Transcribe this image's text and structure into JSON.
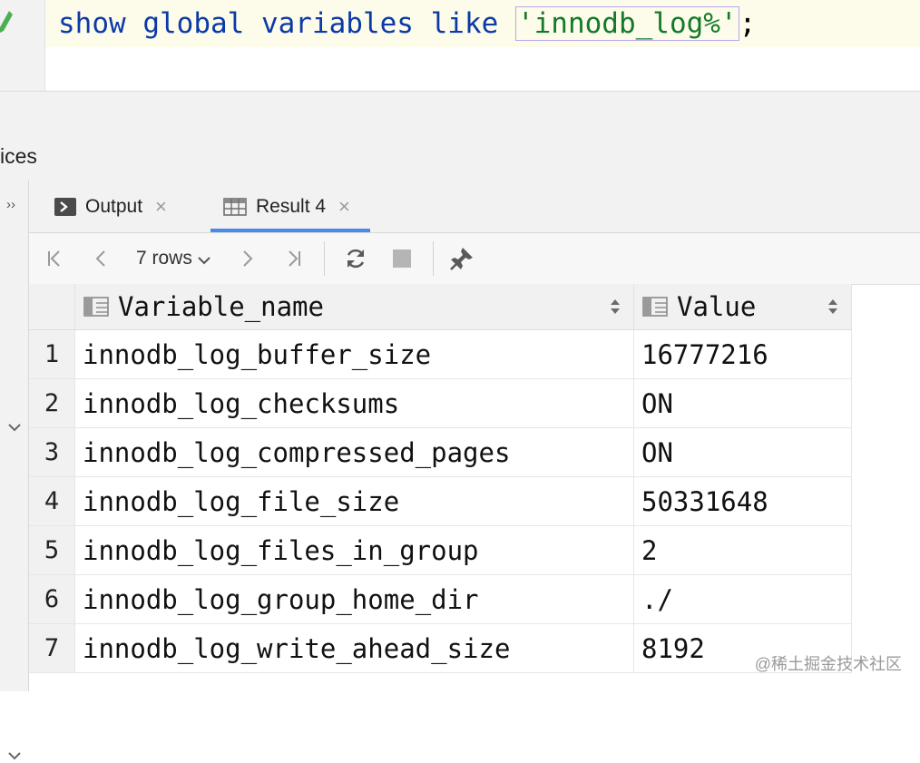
{
  "editor": {
    "query_kw1": "show",
    "query_kw2": "global",
    "query_kw3": "variables",
    "query_kw4": "like",
    "query_string": "'innodb_log%'",
    "query_end": ";"
  },
  "services_panel": {
    "title": "ices"
  },
  "tabs": [
    {
      "label": "Output",
      "close": "×"
    },
    {
      "label": "Result 4",
      "close": "×"
    }
  ],
  "toolbar": {
    "rows_label": "7 rows"
  },
  "table": {
    "columns": [
      {
        "label": "Variable_name"
      },
      {
        "label": "Value"
      }
    ],
    "rows": [
      {
        "num": "1",
        "name": "innodb_log_buffer_size",
        "value": "16777216"
      },
      {
        "num": "2",
        "name": "innodb_log_checksums",
        "value": "ON"
      },
      {
        "num": "3",
        "name": "innodb_log_compressed_pages",
        "value": "ON"
      },
      {
        "num": "4",
        "name": "innodb_log_file_size",
        "value": "50331648"
      },
      {
        "num": "5",
        "name": "innodb_log_files_in_group",
        "value": "2"
      },
      {
        "num": "6",
        "name": "innodb_log_group_home_dir",
        "value": "./"
      },
      {
        "num": "7",
        "name": "innodb_log_write_ahead_size",
        "value": "8192"
      }
    ]
  },
  "watermark": "@稀土掘金技术社区",
  "colors": {
    "accent": "#4a89e8",
    "keyword": "#0b3aa8",
    "string": "#137a2a"
  }
}
